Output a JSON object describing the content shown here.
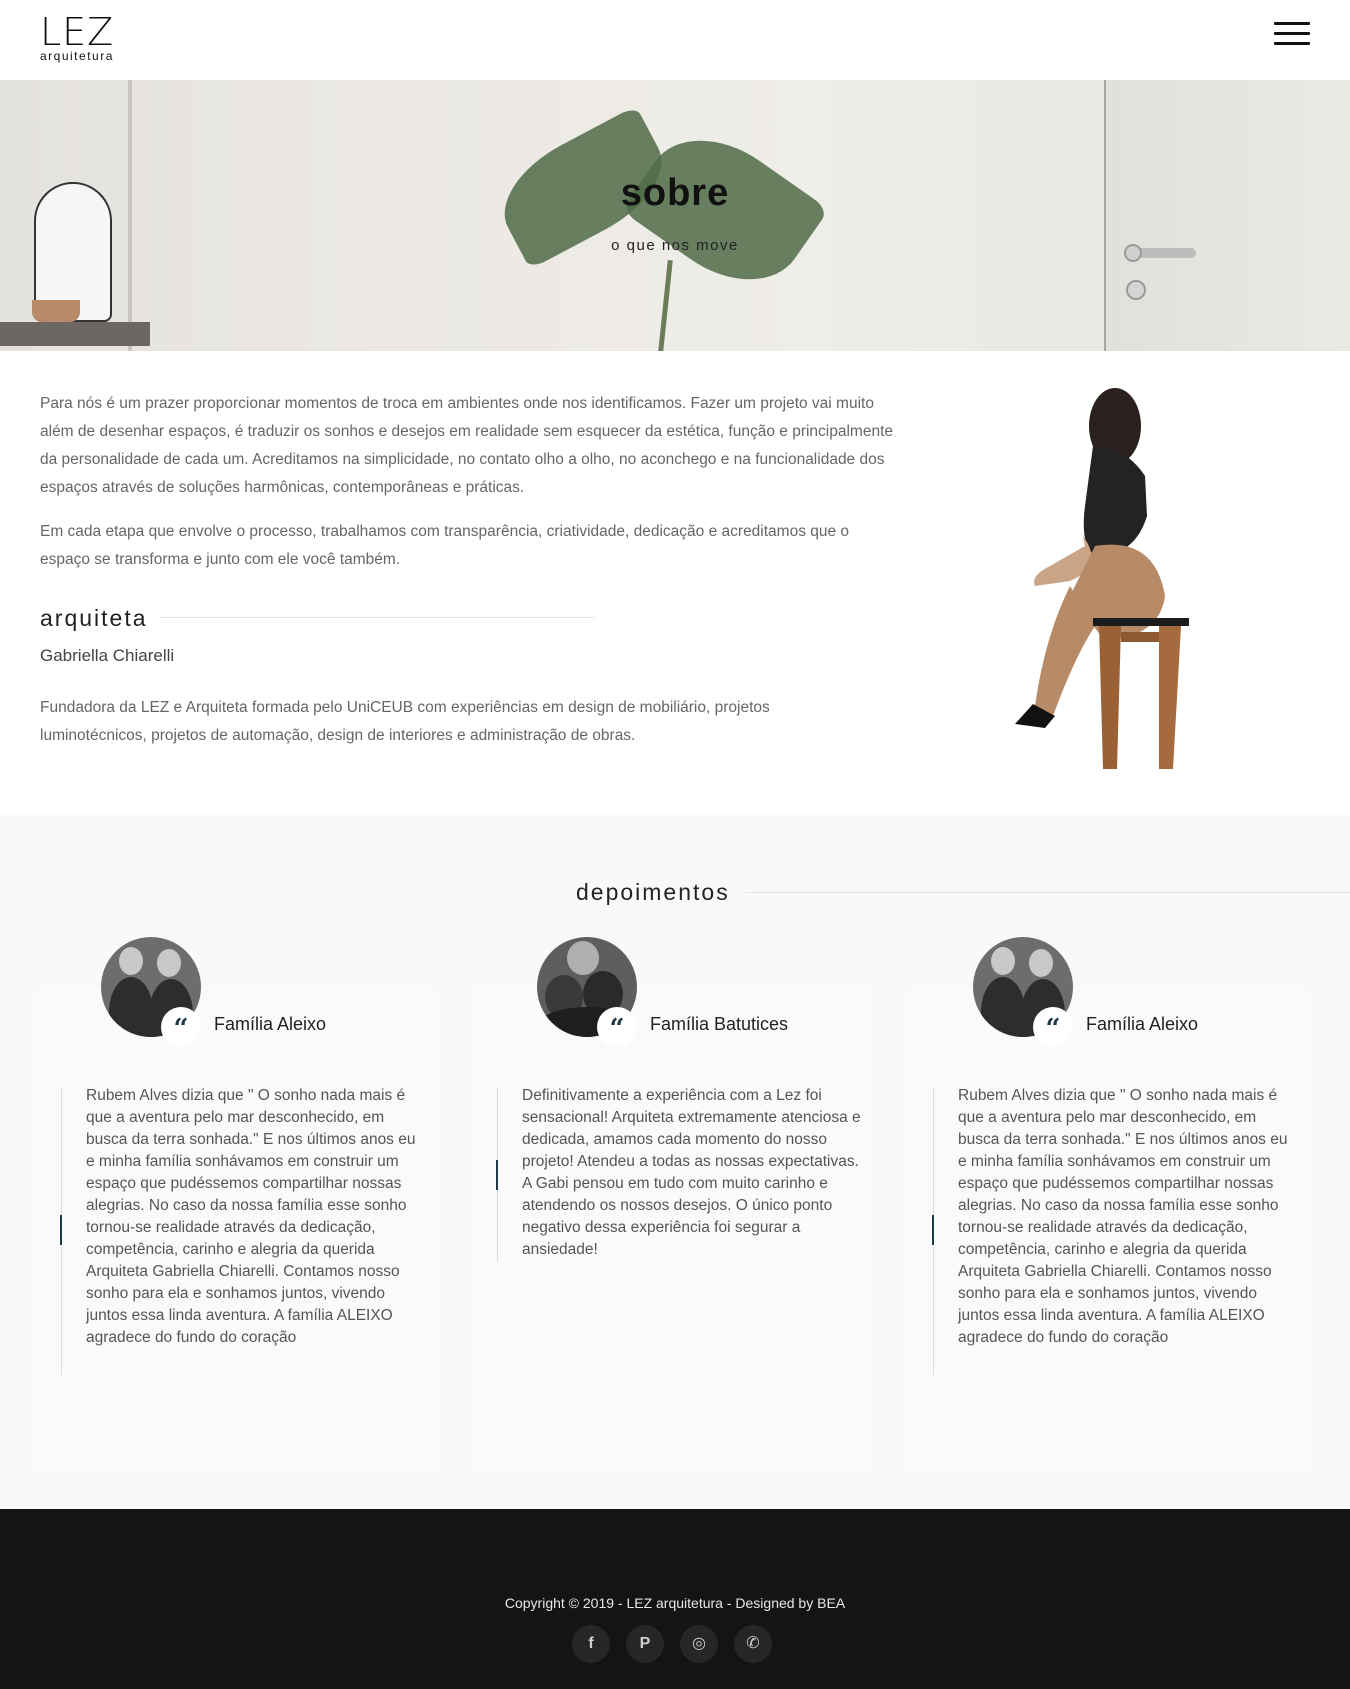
{
  "header": {
    "logo_mark": "LEZ",
    "logo_sub": "arquitetura"
  },
  "hero": {
    "title": "sobre",
    "subtitle": "o que nos move"
  },
  "about": {
    "paragraphs": [
      "Para nós é um prazer proporcionar momentos de troca em ambientes onde nos identificamos. Fazer um projeto vai muito além de desenhar espaços, é traduzir os sonhos e desejos em realidade sem esquecer da estética, função e principalmente da personalidade de cada um. Acreditamos na simplicidade, no contato olho a olho, no aconchego e na funcionalidade dos espaços através de soluções harmônicas, contemporâneas e práticas.",
      "Em cada etapa que envolve o processo, trabalhamos com transparência, criatividade, dedicação e acreditamos que o espaço se transforma e junto com ele você também."
    ],
    "architect_heading": "arquiteta",
    "architect_name": "Gabriella Chiarelli",
    "architect_bio": "Fundadora da LEZ e Arquiteta formada pelo UniCEUB com experiências em design de mobiliário, projetos luminotécnicos, projetos de automação, design de interiores e administração de obras."
  },
  "testimonials": {
    "heading": "depoimentos",
    "items": [
      {
        "name": "Família Aleixo",
        "text": "Rubem Alves dizia que \" O sonho nada mais é que a aventura pelo mar desconhecido, em busca da terra sonhada.\" E nos últimos anos eu e minha família sonhávamos em construir um espaço que pudéssemos compartilhar nossas alegrias. No caso da nossa família esse sonho tornou-se realidade através da dedicação, competência, carinho e alegria da querida Arquiteta Gabriella Chiarelli. Contamos nosso sonho para ela e sonhamos juntos, vivendo juntos essa linda aventura. A família ALEIXO agradece do fundo do coração"
      },
      {
        "name": "Família Batutices",
        "text": "Definitivamente a experiência com a Lez foi sensacional! Arquiteta extremamente atenciosa e dedicada, amamos cada momento do nosso projeto! Atendeu a todas as nossas expectativas. A Gabi pensou em tudo com muito carinho e atendendo os nossos desejos. O único ponto negativo dessa experiência foi segurar a ansiedade!"
      },
      {
        "name": "Família Aleixo",
        "text": "Rubem Alves dizia que \" O sonho nada mais é que a aventura pelo mar desconhecido, em busca da terra sonhada.\" E nos últimos anos eu e minha família sonhávamos em construir um espaço que pudéssemos compartilhar nossas alegrias. No caso da nossa família esse sonho tornou-se realidade através da dedicação, competência, carinho e alegria da querida Arquiteta Gabriella Chiarelli. Contamos nosso sonho para ela e sonhamos juntos, vivendo juntos essa linda aventura. A família ALEIXO agradece do fundo do coração"
      }
    ]
  },
  "footer": {
    "copyright": "Copyright © 2019 - LEZ arquitetura - Designed by BEA",
    "social": [
      {
        "icon": "facebook-icon",
        "glyph": "f"
      },
      {
        "icon": "pinterest-icon",
        "glyph": "P"
      },
      {
        "icon": "instagram-icon",
        "glyph": "◎"
      },
      {
        "icon": "whatsapp-icon",
        "glyph": "✆"
      }
    ]
  },
  "colors": {
    "accent": "#1f3a44",
    "footer_bg": "#141414",
    "section_bg": "#f9f9f9"
  }
}
